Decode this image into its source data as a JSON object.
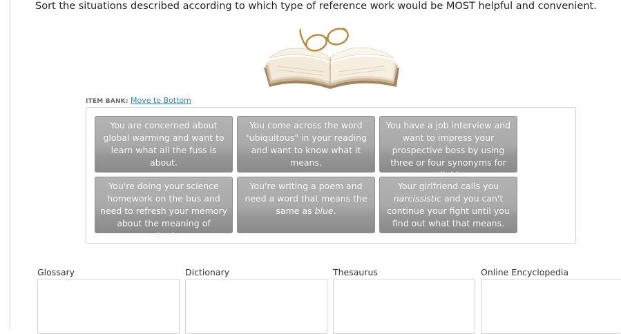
{
  "instructions": "Sort the situations described according to which type of reference work would be MOST helpful and convenient.",
  "item_bank": {
    "label": "ITEM BANK:",
    "move_link": "Move to Bottom",
    "tiles": [
      {
        "pre": "You are concerned about global warming and want to learn what all the fuss is about.",
        "em": "",
        "post": ""
      },
      {
        "pre": "You come across the word \"ubiquitous\" in your reading and want to know what it means.",
        "em": "",
        "post": ""
      },
      {
        "pre": "You have a job interview and want to impress your prospective boss by using three or four synonyms for ",
        "em": "reliable",
        "post": "."
      },
      {
        "pre": "You're doing your science homework on the bus and need to refresh your memory about the meaning of ",
        "em": "mitosis",
        "post": "."
      },
      {
        "pre": "You're writing a poem and need a word that means the same as ",
        "em": "blue",
        "post": "."
      },
      {
        "pre": "Your girlfriend calls you ",
        "em": "narcissistic",
        "post": " and you can't continue your fight until you find out what that means."
      }
    ]
  },
  "categories": [
    {
      "label": "Glossary"
    },
    {
      "label": "Dictionary"
    },
    {
      "label": "Thesaurus"
    },
    {
      "label": "Online Encyclopedia"
    }
  ],
  "icons": {
    "illustration": "open-book-with-glasses"
  }
}
